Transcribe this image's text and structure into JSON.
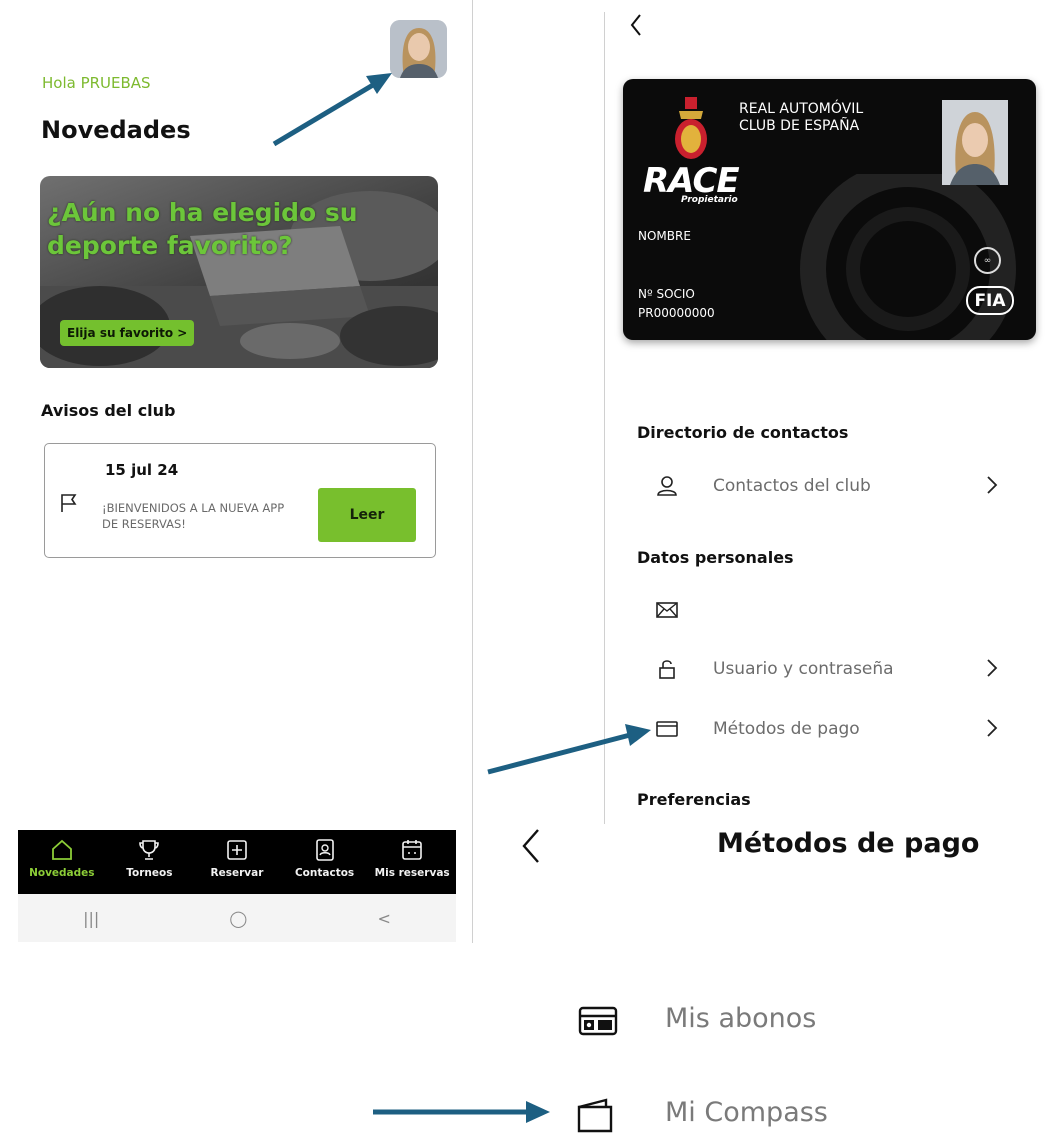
{
  "home": {
    "greeting": "Hola PRUEBAS",
    "title": "Novedades",
    "banner_headline": "¿Aún no ha elegido su deporte favorito?",
    "banner_cta": "Elija su favorito >",
    "notices_title": "Avisos del club",
    "notice": {
      "date": "15 jul 24",
      "text": "¡BIENVENIDOS A LA NUEVA APP DE RESERVAS!",
      "read_label": "Leer"
    },
    "nav": [
      {
        "label": "Novedades",
        "icon": "home-icon",
        "active": true
      },
      {
        "label": "Torneos",
        "icon": "trophy-icon",
        "active": false
      },
      {
        "label": "Reservar",
        "icon": "add-box-icon",
        "active": false
      },
      {
        "label": "Contactos",
        "icon": "contacts-icon",
        "active": false
      },
      {
        "label": "Mis reservas",
        "icon": "calendar-icon",
        "active": false
      }
    ],
    "system_nav": [
      "|||",
      "◯",
      "<"
    ]
  },
  "profile": {
    "card": {
      "club_name_line1": "REAL AUTOMÓVIL",
      "club_name_line2": "CLUB DE ESPAÑA",
      "logo_text": "RACE",
      "logo_sub": "Propietario",
      "name_label": "NOMBRE",
      "partner_label": "Nº SOCIO",
      "partner_number": "PR00000000",
      "fia": "FIA"
    },
    "directory_heading": "Directorio de contactos",
    "club_contacts": "Contactos del club",
    "personal_heading": "Datos personales",
    "user_password": "Usuario y contraseña",
    "payment_methods": "Métodos de pago",
    "preferences_heading": "Preferencias"
  },
  "payment": {
    "title": "Métodos de pago",
    "items": [
      {
        "label": "Mis abonos",
        "icon": "pass-card-icon"
      },
      {
        "label": "Mi Compass",
        "icon": "wallet-icon"
      }
    ]
  },
  "colors": {
    "accent_green": "#78bf2d",
    "arrow_blue": "#1d5f82"
  }
}
